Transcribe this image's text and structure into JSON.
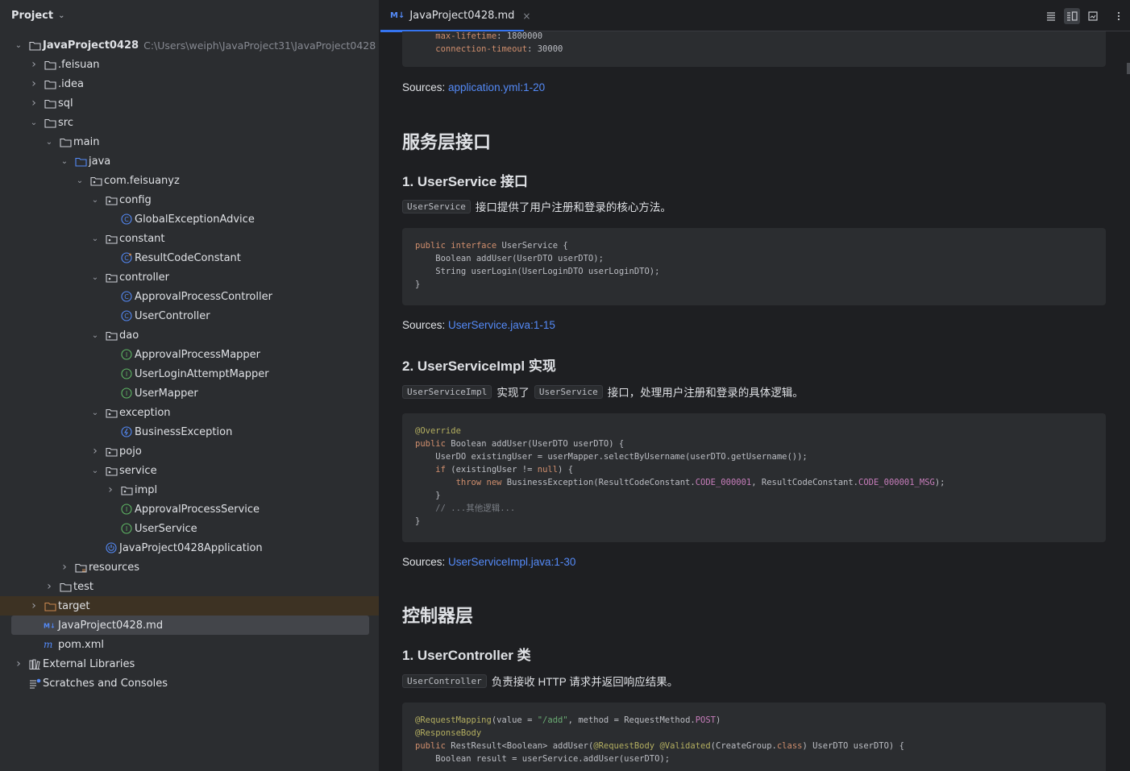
{
  "project_panel": {
    "title": "Project",
    "tree": [
      {
        "depth": 0,
        "expanded": true,
        "icon": "project-folder",
        "label": "JavaProject0428",
        "path": "C:\\Users\\weiph\\JavaProject31\\JavaProject0428",
        "bold": true
      },
      {
        "depth": 1,
        "expanded": false,
        "icon": "folder",
        "label": ".feisuan"
      },
      {
        "depth": 1,
        "expanded": false,
        "icon": "folder",
        "label": ".idea"
      },
      {
        "depth": 1,
        "expanded": false,
        "icon": "folder",
        "label": "sql"
      },
      {
        "depth": 1,
        "expanded": true,
        "icon": "folder",
        "label": "src"
      },
      {
        "depth": 2,
        "expanded": true,
        "icon": "folder",
        "label": "main"
      },
      {
        "depth": 3,
        "expanded": true,
        "icon": "source-folder",
        "label": "java"
      },
      {
        "depth": 4,
        "expanded": true,
        "icon": "package",
        "label": "com.feisuanyz"
      },
      {
        "depth": 5,
        "expanded": true,
        "icon": "package",
        "label": "config"
      },
      {
        "depth": 6,
        "icon": "class",
        "label": "GlobalExceptionAdvice"
      },
      {
        "depth": 5,
        "expanded": true,
        "icon": "package",
        "label": "constant"
      },
      {
        "depth": 6,
        "icon": "class-static",
        "label": "ResultCodeConstant"
      },
      {
        "depth": 5,
        "expanded": true,
        "icon": "package",
        "label": "controller"
      },
      {
        "depth": 6,
        "icon": "class",
        "label": "ApprovalProcessController"
      },
      {
        "depth": 6,
        "icon": "class",
        "label": "UserController"
      },
      {
        "depth": 5,
        "expanded": true,
        "icon": "package",
        "label": "dao"
      },
      {
        "depth": 6,
        "icon": "interface",
        "label": "ApprovalProcessMapper"
      },
      {
        "depth": 6,
        "icon": "interface",
        "label": "UserLoginAttemptMapper"
      },
      {
        "depth": 6,
        "icon": "interface",
        "label": "UserMapper"
      },
      {
        "depth": 5,
        "expanded": true,
        "icon": "package",
        "label": "exception"
      },
      {
        "depth": 6,
        "icon": "exception",
        "label": "BusinessException"
      },
      {
        "depth": 5,
        "expanded": false,
        "icon": "package",
        "label": "pojo"
      },
      {
        "depth": 5,
        "expanded": true,
        "icon": "package",
        "label": "service"
      },
      {
        "depth": 6,
        "expanded": false,
        "icon": "package",
        "label": "impl"
      },
      {
        "depth": 6,
        "icon": "interface",
        "label": "ApprovalProcessService"
      },
      {
        "depth": 6,
        "icon": "interface",
        "label": "UserService"
      },
      {
        "depth": 5,
        "icon": "spring-app",
        "label": "JavaProject0428Application"
      },
      {
        "depth": 3,
        "expanded": false,
        "icon": "resources-folder",
        "label": "resources"
      },
      {
        "depth": 2,
        "expanded": false,
        "icon": "folder",
        "label": "test"
      },
      {
        "depth": 1,
        "expanded": false,
        "icon": "excluded-folder",
        "label": "target",
        "highlight": "excluded"
      },
      {
        "depth": 1,
        "icon": "markdown-file",
        "label": "JavaProject0428.md",
        "highlight": "selected"
      },
      {
        "depth": 1,
        "icon": "maven-file",
        "label": "pom.xml"
      },
      {
        "depth": 0,
        "expanded": false,
        "icon": "library",
        "label": "External Libraries"
      },
      {
        "depth": 0,
        "icon": "scratches",
        "label": "Scratches and Consoles"
      }
    ]
  },
  "editor": {
    "tab": {
      "badge": "M↓",
      "label": "JavaProject0428.md",
      "close": "×"
    },
    "toolbar": [
      "editor-only-icon",
      "split-view-icon",
      "preview-only-icon",
      "more-actions-icon"
    ],
    "doc": {
      "code0": [
        "    max-lifetime: 1800000",
        "    connection-timeout: 30000"
      ],
      "sources0": {
        "prefix": "Sources: ",
        "link": "application.yml:1-20"
      },
      "h_service_layer": "服务层接口",
      "h_userservice": "1. UserService 接口",
      "p_userservice": {
        "code": "UserService",
        "text": "接口提供了用户注册和登录的核心方法。"
      },
      "sources1": {
        "prefix": "Sources: ",
        "link": "UserService.java:1-15"
      },
      "h_userserviceimpl": "2. UserServiceImpl 实现",
      "p_userserviceimpl": {
        "code1": "UserServiceImpl",
        "text1": "实现了",
        "code2": "UserService",
        "text2": "接口，处理用户注册和登录的具体逻辑。"
      },
      "sources2": {
        "prefix": "Sources: ",
        "link": "UserServiceImpl.java:1-30"
      },
      "h_controller_layer": "控制器层",
      "h_usercontroller": "1. UserController 类",
      "p_usercontroller": {
        "code": "UserController",
        "text": "负责接收 HTTP 请求并返回响应结果。"
      }
    }
  }
}
